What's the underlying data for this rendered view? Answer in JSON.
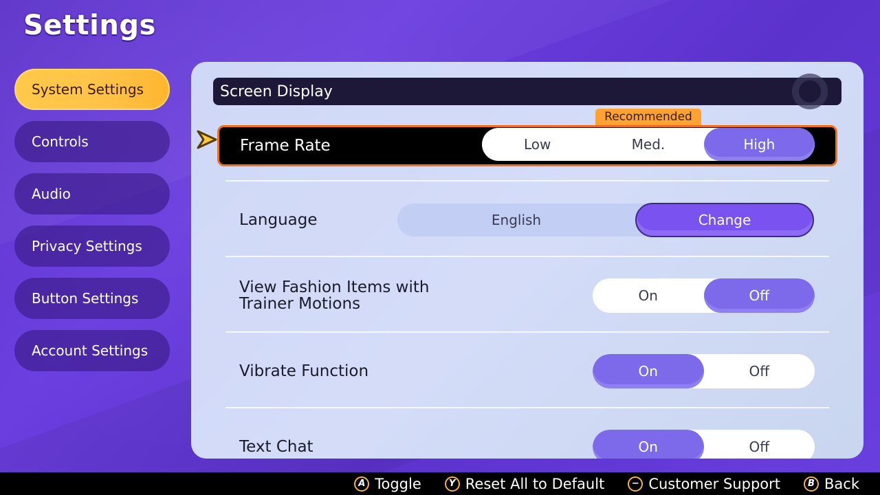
{
  "page": {
    "title": "Settings"
  },
  "sidebar": {
    "items": [
      {
        "label": "System Settings",
        "active": true
      },
      {
        "label": "Controls",
        "active": false
      },
      {
        "label": "Audio",
        "active": false
      },
      {
        "label": "Privacy Settings",
        "active": false
      },
      {
        "label": "Button Settings",
        "active": false
      },
      {
        "label": "Account Settings",
        "active": false
      }
    ]
  },
  "panel": {
    "section_title": "Screen Display",
    "frame_rate": {
      "label": "Frame Rate",
      "options": [
        "Low",
        "Med.",
        "High"
      ],
      "selected": "High",
      "badge": "Recommended"
    },
    "language": {
      "label": "Language",
      "value": "English",
      "button": "Change"
    },
    "fashion": {
      "label_line1": "View Fashion Items with",
      "label_line2": "Trainer Motions",
      "options": [
        "On",
        "Off"
      ],
      "selected": "Off"
    },
    "vibrate": {
      "label": "Vibrate Function",
      "options": [
        "On",
        "Off"
      ],
      "selected": "On"
    },
    "text_chat": {
      "label": "Text Chat",
      "options": [
        "On",
        "Off"
      ],
      "selected": "On"
    }
  },
  "footer": {
    "hints": [
      {
        "glyph": "A",
        "label": "Toggle"
      },
      {
        "glyph": "Y",
        "label": "Reset All to Default"
      },
      {
        "glyph": "−",
        "label": "Customer Support"
      },
      {
        "glyph": "B",
        "label": "Back"
      }
    ]
  },
  "colors": {
    "accent_purple": "#7c6aea",
    "selection_orange": "#f0701a",
    "badge_orange": "#ffa233",
    "active_tab_yellow": "#ffc247"
  }
}
